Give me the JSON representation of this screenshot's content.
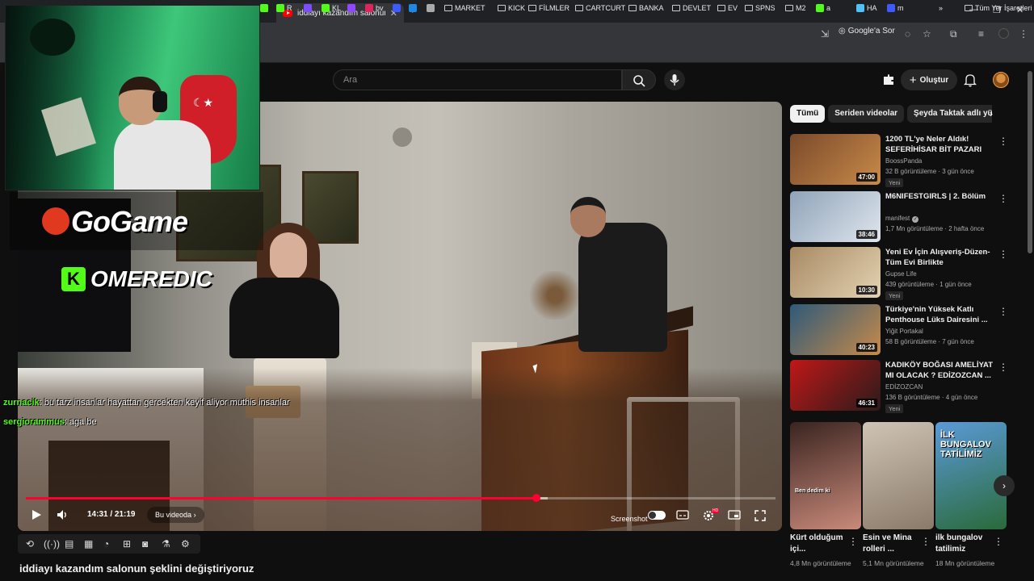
{
  "browser": {
    "active_tab_title": "iddiayı kazandım salonun şekli",
    "google_ask": "Google'a Sor",
    "bookmarks": [
      {
        "label": "R",
        "color": "#53fc18"
      },
      {
        "label": "KL",
        "color": "#53fc18"
      },
      {
        "label": "bv",
        "color": "#e0245e"
      },
      {
        "label": "MARKET",
        "folder": true
      },
      {
        "label": "KICK",
        "folder": true
      },
      {
        "label": "FİLMLER",
        "folder": true
      },
      {
        "label": "CARTCURT",
        "folder": true
      },
      {
        "label": "BANKA",
        "folder": true
      },
      {
        "label": "DEVLET",
        "folder": true
      },
      {
        "label": "EV",
        "folder": true
      },
      {
        "label": "SPNS",
        "folder": true
      },
      {
        "label": "M2",
        "folder": true
      },
      {
        "label": "a",
        "color": "#53fc18"
      },
      {
        "label": "HA",
        "color": "#4fc3f7"
      },
      {
        "label": "m",
        "color": "#3d5afe"
      }
    ],
    "all_bookmarks": "Tüm Yer İşaretleri"
  },
  "youtube": {
    "search_placeholder": "Ara",
    "create_label": "Oluştur"
  },
  "stream_overlay": {
    "brand_logo": "GoGame",
    "kick_channel": "OMEREDIC",
    "chat": [
      {
        "user": "zurnacik",
        "user_color": "#53fc18",
        "message": ": bu tarz insanlar hayattan gercekten keyif aliyor muthis insanlar"
      },
      {
        "user": "sergiorammus",
        "user_color": "#53fc18",
        "message": ": aga be"
      }
    ]
  },
  "player": {
    "current_time": "14:31",
    "duration": "21:19",
    "time_display": "14:31 / 21:19",
    "progress_fraction": 0.6806,
    "buffered_fraction": 0.696,
    "chapter_label": "Bu videoda",
    "screenshot_label": "Screenshot",
    "hd_badge": "HD"
  },
  "video_title": "iddiayı kazandım salonun şeklini değiştiriyoruz",
  "chips": [
    "Tümü",
    "Seriden videolar",
    "Şeyda Taktak adlı yük"
  ],
  "recommendations": [
    {
      "title": "1200 TL'ye Neler Aldık! SEFERİHİSAR BİT PAZARI #268",
      "channel": "BoossPanda",
      "meta": "32 B görüntüleme · 3 gün önce",
      "badge": "Yeni",
      "duration": "47:00",
      "thumb_colors": [
        "#7a4a2a",
        "#c98a4a"
      ]
    },
    {
      "title": "M6NIFESTGIRLS | 2. Bölüm",
      "channel": "manifest",
      "verified": true,
      "meta": "1,7 Mn görüntüleme · 2 hafta önce",
      "badge": "",
      "duration": "38:46",
      "thumb_colors": [
        "#8fa3b8",
        "#dfe6ee"
      ]
    },
    {
      "title": "Yeni Ev İçin Alışveriş-Düzen-Tüm Evi Birlikte Düzenliyoruz. ...",
      "channel": "Gupse Life",
      "meta": "439 görüntüleme · 1 gün önce",
      "badge": "Yeni",
      "duration": "10:30",
      "thumb_colors": [
        "#a88a64",
        "#e3d2b2"
      ]
    },
    {
      "title": "Türkiye'nin Yüksek Katlı Penthouse Lüks Dairesini ...",
      "channel": "Yiğit Portakal",
      "meta": "58 B görüntüleme · 7 gün önce",
      "badge": "",
      "duration": "40:23",
      "thumb_colors": [
        "#2e5a7a",
        "#c78a4a"
      ]
    },
    {
      "title": "KADIKÖY BOĞASI AMELİYAT MI OLACAK ? EDİZOZCAN ...",
      "channel": "EDİZOZCAN",
      "meta": "136 B görüntüleme · 4 gün önce",
      "badge": "Yeni",
      "duration": "46:31",
      "thumb_colors": [
        "#c01818",
        "#2a1a1a"
      ]
    }
  ],
  "shorts": [
    {
      "title": "Kürt olduğum içi...",
      "meta": "4,8 Mn görüntüleme",
      "caption": "Ben dedim ki",
      "thumb_colors": [
        "#3a2420",
        "#c98a7a"
      ]
    },
    {
      "title": "Esin ve Mina rolleri ...",
      "meta": "5,1 Mn görüntüleme",
      "caption": "",
      "thumb_colors": [
        "#cfc4b4",
        "#8a7a6a"
      ]
    },
    {
      "title": "ilk bungalov tatilimiz",
      "meta": "18 Mn görüntüleme",
      "caption": "İLK BUNGALOV TATİLİMİZ",
      "thumb_colors": [
        "#5a9ad8",
        "#2a6a3a"
      ]
    }
  ]
}
